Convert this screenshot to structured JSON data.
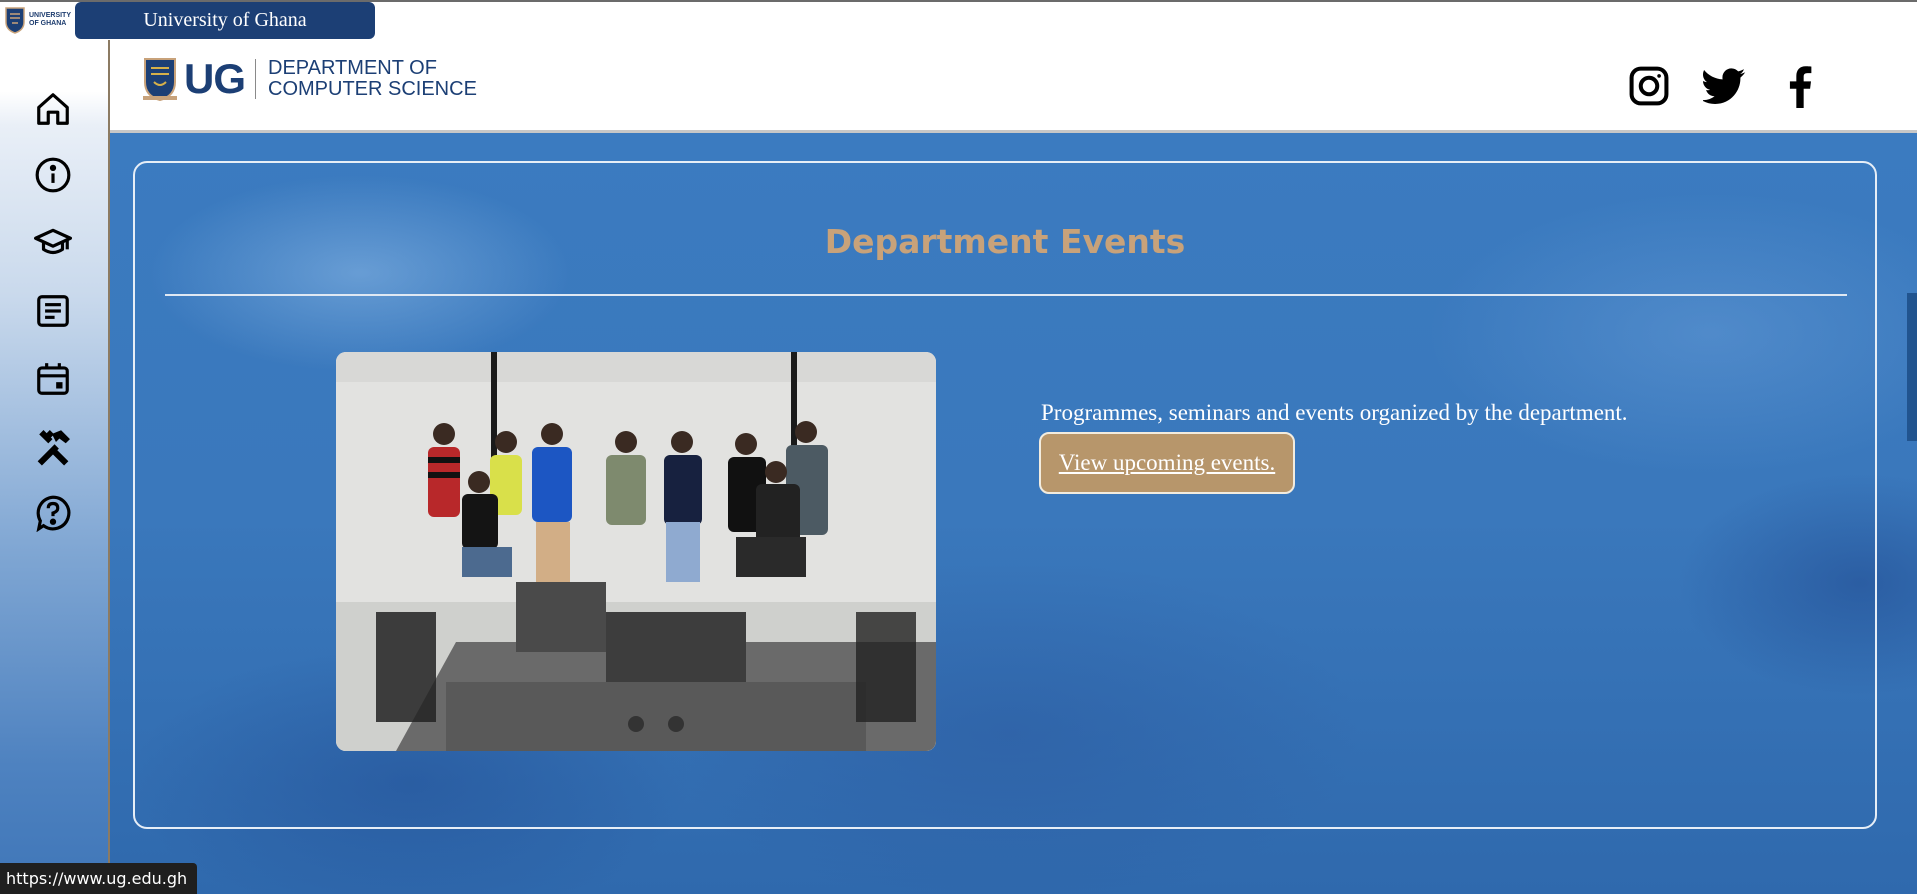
{
  "browser": {
    "tab_label": "University of Ghana",
    "status_url": "https://www.ug.edu.gh"
  },
  "mini_logo": {
    "line1": "UNIVERSITY",
    "line2": "OF GHANA"
  },
  "header": {
    "logo_abbrev": "UG",
    "dept_line1": "DEPARTMENT OF",
    "dept_line2": "COMPUTER SCIENCE",
    "social_icons": [
      "instagram-icon",
      "twitter-icon",
      "facebook-icon"
    ]
  },
  "sidebar": {
    "icons": [
      "home-icon",
      "info-icon",
      "graduation-cap-icon",
      "article-icon",
      "calendar-icon",
      "tools-icon",
      "help-icon"
    ]
  },
  "events": {
    "title": "Department Events",
    "description": "Programmes, seminars and events organized by the department.",
    "button_label": "View upcoming events."
  },
  "colors": {
    "brand_navy": "#1c3f75",
    "accent_gold": "#c8a27a",
    "button_tan": "#b7966b",
    "background_blue": "#3a78bc"
  }
}
